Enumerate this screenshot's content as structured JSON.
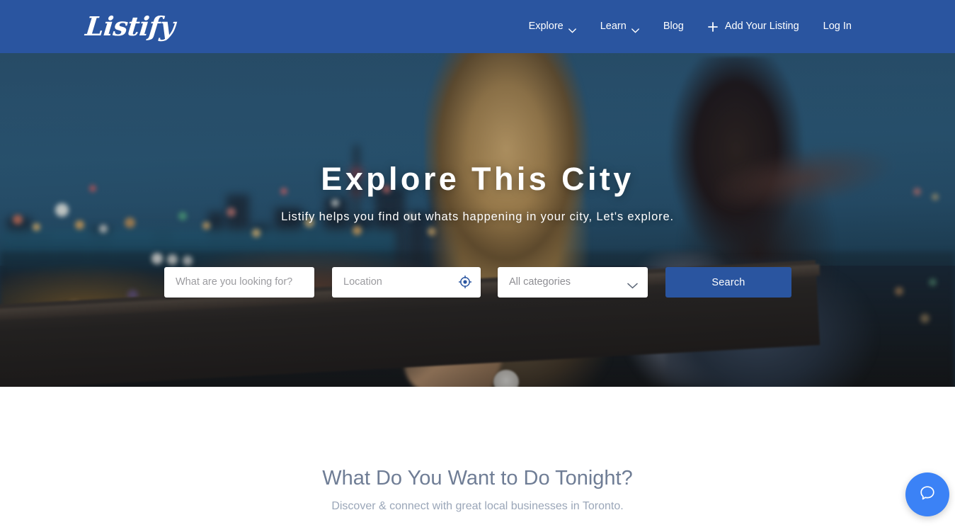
{
  "header": {
    "logo_text": "Listify",
    "nav": [
      {
        "label": "Explore",
        "icon": "chevron-down-icon",
        "has_dropdown": true
      },
      {
        "label": "Learn",
        "icon": "chevron-down-icon",
        "has_dropdown": true
      },
      {
        "label": "Blog",
        "has_dropdown": false
      },
      {
        "label": "Add Your Listing",
        "icon": "plus-icon",
        "has_dropdown": false
      },
      {
        "label": "Log In",
        "has_dropdown": false
      }
    ],
    "background_color": "#2a55a0"
  },
  "hero": {
    "title": "Explore This City",
    "subtitle": "Listify helps you find out whats happening in your city, Let's explore.",
    "search": {
      "keyword_placeholder": "What are you looking for?",
      "keyword_value": "",
      "location_placeholder": "Location",
      "location_value": "",
      "geo_icon": "crosshair-locate-icon",
      "category_selected": "All categories",
      "category_options": [
        "All categories"
      ],
      "category_icon": "chevron-down-icon",
      "search_button": "Search",
      "button_color": "#2a55a0"
    }
  },
  "main": {
    "section_title": "What Do You Want to Do Tonight?",
    "section_subtitle": "Discover & connect with great local businesses in Toronto.",
    "title_color": "#6f7d95",
    "subtitle_color": "#9aa6b8"
  },
  "widgets": {
    "chat": {
      "icon": "chat-bubble-icon",
      "color": "#3b82f6",
      "label": ""
    }
  }
}
